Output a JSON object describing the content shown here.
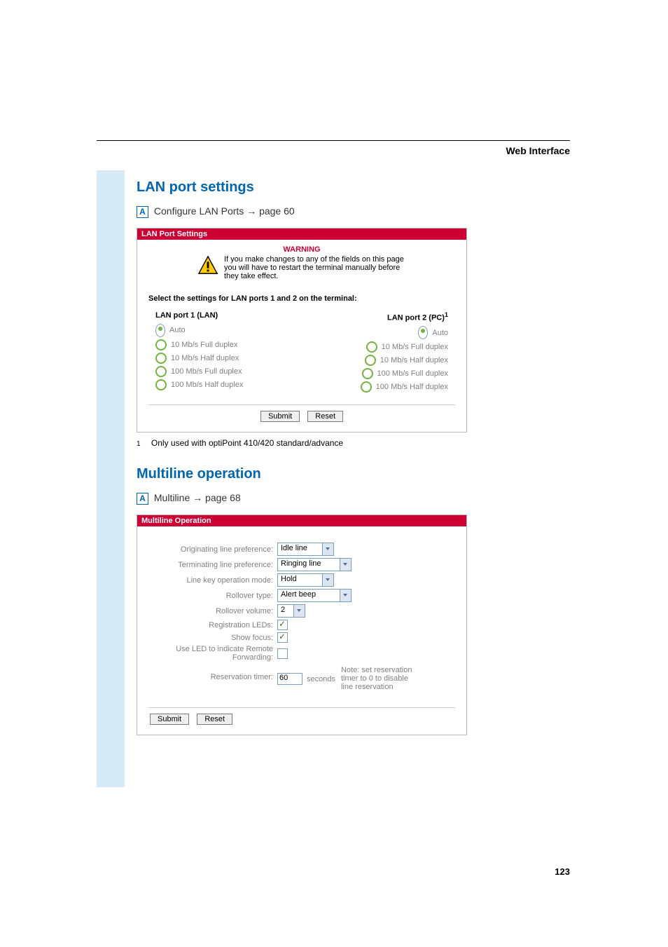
{
  "header": {
    "category": "Web Interface"
  },
  "sections": {
    "lan": {
      "title": "LAN port settings",
      "crossref_prefix": "Configure LAN Ports ",
      "crossref_arrow": "→",
      "crossref_page": " page 60",
      "panel_header": "LAN Port Settings",
      "warning_title": "WARNING",
      "warning_text": "If you make changes to any of the fields on this page you will have to restart the terminal manually before they take effect.",
      "select_label": "Select the settings for LAN ports 1 and 2 on the terminal:",
      "col1_head": "LAN port 1 (LAN)",
      "col2_head_prefix": "LAN port 2 (PC)",
      "col2_head_sup": "1",
      "options": {
        "auto": "Auto",
        "f10": "10 Mb/s Full duplex",
        "h10": "10 Mb/s Half duplex",
        "f100": "100 Mb/s Full duplex",
        "h100": "100 Mb/s Half duplex"
      },
      "submit": "Submit",
      "reset": "Reset",
      "footnote_num": "1",
      "footnote_text": "Only used with optiPoint 410/420 standard/advance"
    },
    "multi": {
      "title": "Multiline operation",
      "crossref_prefix": "Multiline ",
      "crossref_arrow": "→",
      "crossref_page": " page 68",
      "panel_header": "Multiline Operation",
      "labels": {
        "orig": "Originating line preference:",
        "term": "Terminating line preference:",
        "lkey": "Line key operation mode:",
        "rtype": "Rollover type:",
        "rvol": "Rollover volume:",
        "rled": "Registration LEDs:",
        "focus": "Show focus:",
        "fwd": "Use LED to indicate Remote Forwarding:",
        "restimer": "Reservation timer:"
      },
      "values": {
        "orig": "Idle line",
        "term": "Ringing line",
        "lkey": "Hold",
        "rtype": "Alert beep",
        "rvol": "2",
        "restimer": "60"
      },
      "seconds_label": "seconds",
      "note": "Note: set reservation timer to 0 to disable line reservation",
      "submit": "Submit",
      "reset": "Reset"
    }
  },
  "page_number": "123"
}
